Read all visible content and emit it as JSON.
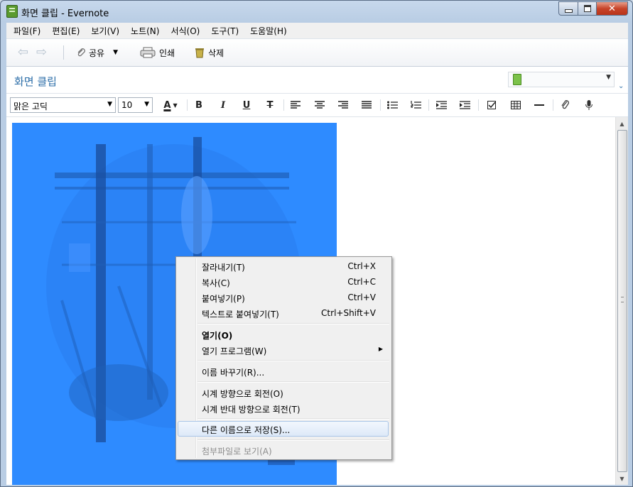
{
  "window": {
    "title": "화면 클립 - Evernote"
  },
  "menubar": {
    "items": [
      "파일(F)",
      "편집(E)",
      "보기(V)",
      "노트(N)",
      "서식(O)",
      "도구(T)",
      "도움말(H)"
    ]
  },
  "toolbar": {
    "share_label": "공유",
    "print_label": "인쇄",
    "delete_label": "삭제"
  },
  "note": {
    "title": "화면 클립",
    "notebook": ""
  },
  "format": {
    "font": "맑은 고딕",
    "size": "10",
    "bold_glyph": "B",
    "italic_glyph": "I",
    "underline_glyph": "U",
    "strike_glyph": "T",
    "color_glyph": "A"
  },
  "context_menu": {
    "items": [
      {
        "label": "잘라내기(T)",
        "shortcut": "Ctrl+X"
      },
      {
        "label": "복사(C)",
        "shortcut": "Ctrl+C"
      },
      {
        "label": "붙여넣기(P)",
        "shortcut": "Ctrl+V"
      },
      {
        "label": "텍스트로 붙여넣기(T)",
        "shortcut": "Ctrl+Shift+V"
      },
      {
        "label": "열기(O)",
        "shortcut": ""
      },
      {
        "label": "열기 프로그램(W)",
        "shortcut": ""
      },
      {
        "label": "이름 바꾸기(R)...",
        "shortcut": ""
      },
      {
        "label": "시계 방향으로 회전(O)",
        "shortcut": ""
      },
      {
        "label": "시계 반대 방향으로 회전(T)",
        "shortcut": ""
      },
      {
        "label": "다른 이름으로 저장(S)...",
        "shortcut": ""
      },
      {
        "label": "첨부파일로 보기(A)",
        "shortcut": ""
      }
    ]
  },
  "colors": {
    "accent": "#2c6ea8",
    "selection": "#2e8bff"
  }
}
